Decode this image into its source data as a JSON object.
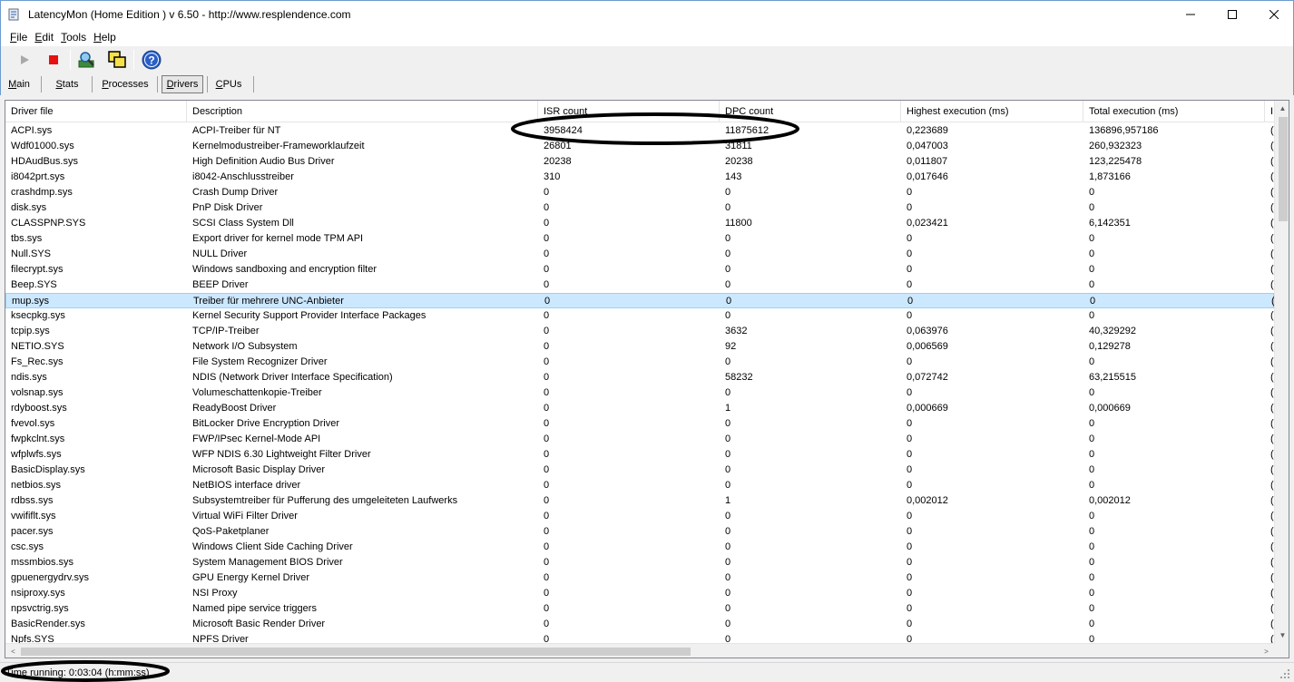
{
  "window": {
    "title": "LatencyMon  (Home Edition )  v 6.50 - http://www.resplendence.com",
    "minimize": "—",
    "maximize": "☐",
    "close": "✕"
  },
  "menu": {
    "file_u": "F",
    "file_rest": "ile",
    "edit_u": "E",
    "edit_rest": "dit",
    "tools_u": "T",
    "tools_rest": "ools",
    "help_u": "H",
    "help_rest": "elp"
  },
  "toolbar": {
    "icons": [
      "play-icon",
      "stop-icon",
      "analyze-icon",
      "windows-icon",
      "help-icon"
    ]
  },
  "tabs": [
    {
      "u": "M",
      "rest": "ain",
      "active": false
    },
    {
      "u": "S",
      "rest": "tats",
      "active": false
    },
    {
      "u": "P",
      "rest": "rocesses",
      "active": false
    },
    {
      "u": "D",
      "rest": "rivers",
      "active": true
    },
    {
      "u": "C",
      "rest": "PUs",
      "active": false
    }
  ],
  "table": {
    "headers": [
      "Driver file",
      "Description",
      "ISR count",
      "DPC count",
      "Highest execution (ms)",
      "Total execution (ms)",
      "I"
    ],
    "selected_row": 11,
    "rows": [
      [
        "ACPI.sys",
        "ACPI-Treiber für NT",
        "3958424",
        "11875612",
        "0,223689",
        "136896,957186",
        "("
      ],
      [
        "Wdf01000.sys",
        "Kernelmodustreiber-Frameworklaufzeit",
        "26801",
        "31811",
        "0,047003",
        "260,932323",
        "("
      ],
      [
        "HDAudBus.sys",
        "High Definition Audio Bus Driver",
        "20238",
        "20238",
        "0,011807",
        "123,225478",
        "("
      ],
      [
        "i8042prt.sys",
        "i8042-Anschlusstreiber",
        "310",
        "143",
        "0,017646",
        "1,873166",
        "("
      ],
      [
        "crashdmp.sys",
        "Crash Dump Driver",
        "0",
        "0",
        "0",
        "0",
        "("
      ],
      [
        "disk.sys",
        "PnP Disk Driver",
        "0",
        "0",
        "0",
        "0",
        "("
      ],
      [
        "CLASSPNP.SYS",
        "SCSI Class System Dll",
        "0",
        "11800",
        "0,023421",
        "6,142351",
        "("
      ],
      [
        "tbs.sys",
        "Export driver for kernel mode TPM API",
        "0",
        "0",
        "0",
        "0",
        "("
      ],
      [
        "Null.SYS",
        "NULL Driver",
        "0",
        "0",
        "0",
        "0",
        "("
      ],
      [
        "filecrypt.sys",
        "Windows sandboxing and encryption filter",
        "0",
        "0",
        "0",
        "0",
        "("
      ],
      [
        "Beep.SYS",
        "BEEP Driver",
        "0",
        "0",
        "0",
        "0",
        "("
      ],
      [
        "mup.sys",
        "Treiber für mehrere UNC-Anbieter",
        "0",
        "0",
        "0",
        "0",
        "("
      ],
      [
        "ksecpkg.sys",
        "Kernel Security Support Provider Interface Packages",
        "0",
        "0",
        "0",
        "0",
        "("
      ],
      [
        "tcpip.sys",
        "TCP/IP-Treiber",
        "0",
        "3632",
        "0,063976",
        "40,329292",
        "("
      ],
      [
        "NETIO.SYS",
        "Network I/O Subsystem",
        "0",
        "92",
        "0,006569",
        "0,129278",
        "("
      ],
      [
        "Fs_Rec.sys",
        "File System Recognizer Driver",
        "0",
        "0",
        "0",
        "0",
        "("
      ],
      [
        "ndis.sys",
        "NDIS (Network Driver Interface Specification)",
        "0",
        "58232",
        "0,072742",
        "63,215515",
        "("
      ],
      [
        "volsnap.sys",
        "Volumeschattenkopie-Treiber",
        "0",
        "0",
        "0",
        "0",
        "("
      ],
      [
        "rdyboost.sys",
        "ReadyBoost Driver",
        "0",
        "1",
        "0,000669",
        "0,000669",
        "("
      ],
      [
        "fvevol.sys",
        "BitLocker Drive Encryption Driver",
        "0",
        "0",
        "0",
        "0",
        "("
      ],
      [
        "fwpkclnt.sys",
        "FWP/IPsec Kernel-Mode API",
        "0",
        "0",
        "0",
        "0",
        "("
      ],
      [
        "wfplwfs.sys",
        "WFP NDIS 6.30 Lightweight Filter Driver",
        "0",
        "0",
        "0",
        "0",
        "("
      ],
      [
        "BasicDisplay.sys",
        "Microsoft Basic Display Driver",
        "0",
        "0",
        "0",
        "0",
        "("
      ],
      [
        "netbios.sys",
        "NetBIOS interface driver",
        "0",
        "0",
        "0",
        "0",
        "("
      ],
      [
        "rdbss.sys",
        "Subsystemtreiber für Pufferung des umgeleiteten Laufwerks",
        "0",
        "1",
        "0,002012",
        "0,002012",
        "("
      ],
      [
        "vwififlt.sys",
        "Virtual WiFi Filter Driver",
        "0",
        "0",
        "0",
        "0",
        "("
      ],
      [
        "pacer.sys",
        "QoS-Paketplaner",
        "0",
        "0",
        "0",
        "0",
        "("
      ],
      [
        "csc.sys",
        "Windows Client Side Caching Driver",
        "0",
        "0",
        "0",
        "0",
        "("
      ],
      [
        "mssmbios.sys",
        "System Management BIOS Driver",
        "0",
        "0",
        "0",
        "0",
        "("
      ],
      [
        "gpuenergydrv.sys",
        "GPU Energy Kernel Driver",
        "0",
        "0",
        "0",
        "0",
        "("
      ],
      [
        "nsiproxy.sys",
        "NSI Proxy",
        "0",
        "0",
        "0",
        "0",
        "("
      ],
      [
        "npsvctrig.sys",
        "Named pipe service triggers",
        "0",
        "0",
        "0",
        "0",
        "("
      ],
      [
        "BasicRender.sys",
        "Microsoft Basic Render Driver",
        "0",
        "0",
        "0",
        "0",
        "("
      ],
      [
        "Npfs.SYS",
        "NPFS Driver",
        "0",
        "0",
        "0",
        "0",
        "("
      ]
    ]
  },
  "scroll": {
    "up": "▲",
    "down": "▼",
    "left": "<",
    "right": ">"
  },
  "status": {
    "text": "Time running: 0:03:04  (h:mm:ss)"
  },
  "colors": {
    "selection": "#cce8ff",
    "selection_border": "#99d1ff",
    "annotation": "#000000"
  }
}
